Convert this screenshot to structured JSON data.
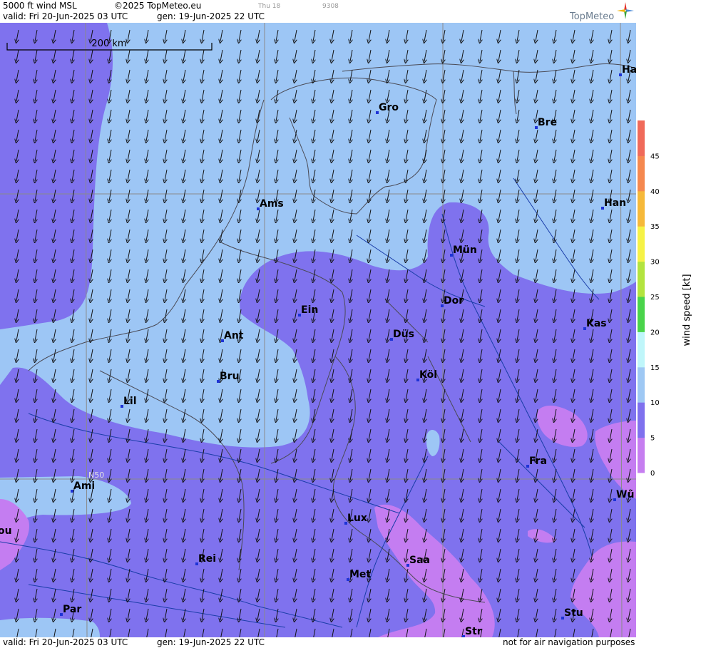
{
  "header": {
    "product": "5000 ft wind MSL",
    "copyright": "©2025 TopMeteo.eu",
    "valid": "valid:  Fri  20-Jun-2025  03 UTC",
    "gen": "gen: 19-Jun-2025 22 UTC",
    "faint_day": "Thu 18",
    "faint_code": "9308",
    "brand": "TopMeteo"
  },
  "footer": {
    "valid": "valid:  Fri  20-Jun-2025  03 UTC",
    "gen": "gen: 19-Jun-2025 22 UTC",
    "disclaimer": "not for air navigation purposes"
  },
  "scale": {
    "label": "200 km"
  },
  "grid": {
    "lat_label": "N50"
  },
  "cities": [
    {
      "name": "Ha"
    },
    {
      "name": "Gro"
    },
    {
      "name": "Bre"
    },
    {
      "name": "Ams"
    },
    {
      "name": "Han"
    },
    {
      "name": "Mün"
    },
    {
      "name": "Dor"
    },
    {
      "name": "Ein"
    },
    {
      "name": "Kas"
    },
    {
      "name": "Ant"
    },
    {
      "name": "Düs"
    },
    {
      "name": "Köl"
    },
    {
      "name": "Bru"
    },
    {
      "name": "Lil"
    },
    {
      "name": "Fra"
    },
    {
      "name": "Ami"
    },
    {
      "name": "Wü"
    },
    {
      "name": "Lux"
    },
    {
      "name": "ou"
    },
    {
      "name": "Rei"
    },
    {
      "name": "Saa"
    },
    {
      "name": "Met"
    },
    {
      "name": "Stu"
    },
    {
      "name": "Par"
    },
    {
      "name": "Str"
    }
  ],
  "legend": {
    "title": "wind  speed  [kt]",
    "ticks": [
      "0",
      "5",
      "10",
      "15",
      "20",
      "25",
      "30",
      "35",
      "40",
      "45"
    ],
    "colors": [
      "#c67ef0",
      "#7f71ee",
      "#9ec8f4",
      "#bff6fa",
      "#4ad44b",
      "#b3e43f",
      "#f6f246",
      "#f6b93a",
      "#f5884f",
      "#f06a5a"
    ]
  },
  "colors": {
    "light_blue": "#9dc6f5",
    "blue_purple": "#7f72ee",
    "violet": "#c47df1",
    "grid": "#8a8a8a",
    "border": "#4a4a55",
    "river": "#1a3da8"
  },
  "wind": {
    "direction": "from north-north-east, arrows pointing south-south-west",
    "typical_speed_kt": "5-10"
  }
}
